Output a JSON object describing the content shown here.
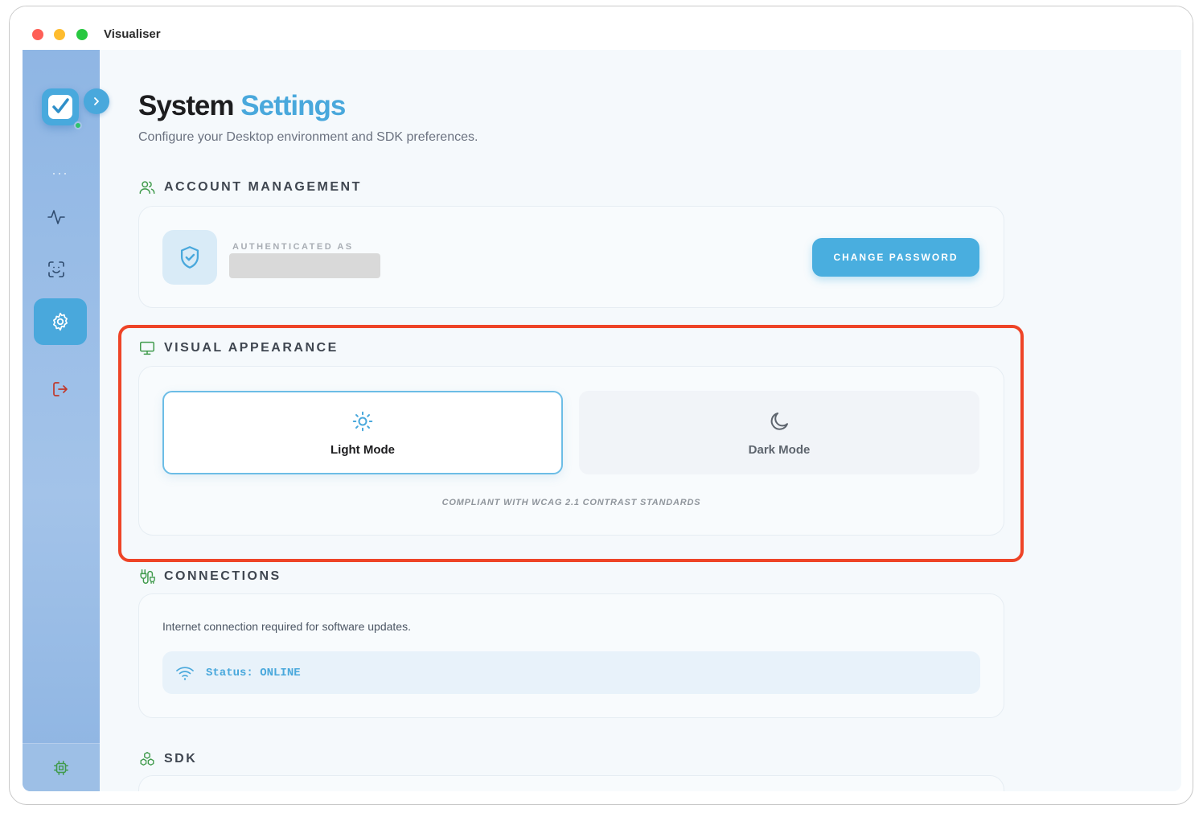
{
  "window": {
    "title": "Visualiser"
  },
  "sidebar": {
    "expand_icon": "chevron-right-icon",
    "more": "···",
    "items": [
      {
        "icon": "activity-icon"
      },
      {
        "icon": "face-scan-icon"
      },
      {
        "icon": "gear-icon",
        "active": true
      },
      {
        "icon": "logout-icon"
      }
    ],
    "bottom_icon": "chip-icon"
  },
  "header": {
    "title_part1": "System",
    "title_part2": "Settings",
    "subtitle": "Configure your Desktop environment and SDK preferences."
  },
  "account": {
    "heading": "ACCOUNT MANAGEMENT",
    "auth_label": "AUTHENTICATED AS",
    "change_password": "CHANGE PASSWORD"
  },
  "appearance": {
    "heading": "VISUAL APPEARANCE",
    "light_mode": "Light Mode",
    "dark_mode": "Dark Mode",
    "selected": "Light Mode",
    "compliance": "COMPLIANT WITH WCAG 2.1 CONTRAST STANDARDS"
  },
  "connections": {
    "heading": "CONNECTIONS",
    "description": "Internet connection required for software updates.",
    "status": "Status: ONLINE"
  },
  "sdk": {
    "heading": "SDK"
  },
  "colors": {
    "accent": "#49a8dc",
    "section_icon": "#3f9a4b",
    "highlight": "#ee4427",
    "logout": "#c0392b"
  }
}
